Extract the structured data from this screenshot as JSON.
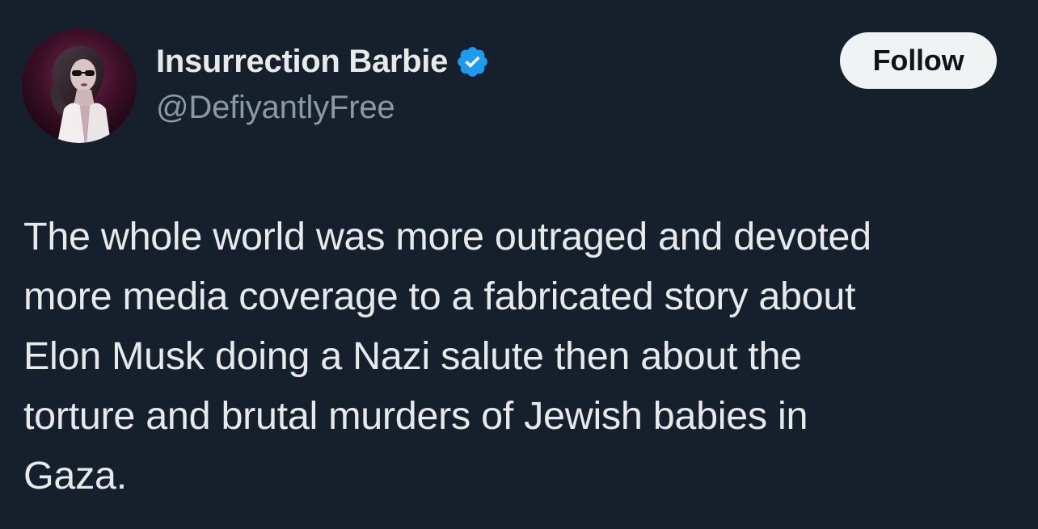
{
  "author": {
    "display_name": "Insurrection Barbie",
    "handle": "@DefiyantlyFree",
    "verified": true,
    "avatar_icon": "profile-photo",
    "verified_icon": "verified-badge-icon"
  },
  "actions": {
    "follow_label": "Follow"
  },
  "tweet": {
    "lines": [
      "The whole world was more outraged and devoted",
      "more media coverage to a fabricated story about",
      "Elon Musk doing a Nazi salute then about the",
      "torture and brutal murders of Jewish babies in",
      "Gaza."
    ]
  },
  "colors": {
    "background": "#16202c",
    "text_primary": "#e7e9ea",
    "text_secondary": "#8b98a5",
    "verified_blue": "#1d9bf0",
    "follow_bg": "#eff3f4"
  }
}
